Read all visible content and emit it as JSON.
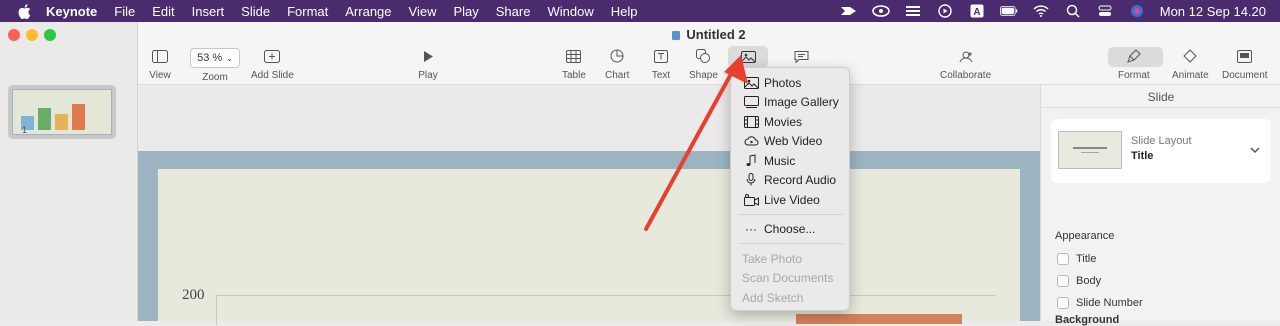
{
  "menubar": {
    "app": "Keynote",
    "items": [
      "File",
      "Edit",
      "Insert",
      "Slide",
      "Format",
      "Arrange",
      "View",
      "Play",
      "Share",
      "Window",
      "Help"
    ],
    "clock": "Mon 12 Sep  14.20"
  },
  "window": {
    "title": "Untitled 2"
  },
  "toolbar": {
    "view": "View",
    "zoom_value": "53 %",
    "zoom": "Zoom",
    "add_slide": "Add Slide",
    "play": "Play",
    "table": "Table",
    "chart": "Chart",
    "text": "Text",
    "shape": "Shape",
    "comment": "",
    "collaborate": "Collaborate",
    "format": "Format",
    "animate": "Animate",
    "document": "Document"
  },
  "navigator": {
    "slide_number": "1"
  },
  "slide": {
    "y_tick": "200"
  },
  "media_menu": {
    "items": [
      {
        "label": "Photos",
        "icon": "photos-icon"
      },
      {
        "label": "Image Gallery",
        "icon": "image-gallery-icon"
      },
      {
        "label": "Movies",
        "icon": "movies-icon"
      },
      {
        "label": "Web Video",
        "icon": "web-video-icon"
      },
      {
        "label": "Music",
        "icon": "music-icon"
      },
      {
        "label": "Record Audio",
        "icon": "microphone-icon"
      },
      {
        "label": "Live Video",
        "icon": "live-video-icon"
      }
    ],
    "choose": "Choose...",
    "disabled": [
      "Take Photo",
      "Scan Documents",
      "Add Sketch"
    ]
  },
  "inspector": {
    "title": "Slide",
    "layout_label": "Slide Layout",
    "layout_value": "Title",
    "appearance": "Appearance",
    "checks": [
      "Title",
      "Body",
      "Slide Number"
    ],
    "background": "Background"
  },
  "colors": {
    "menubar": "#4a2c6e",
    "arrow": "#e8402f",
    "slide_border": "#9cb4c2",
    "slide_bg": "#e7e9dc"
  }
}
